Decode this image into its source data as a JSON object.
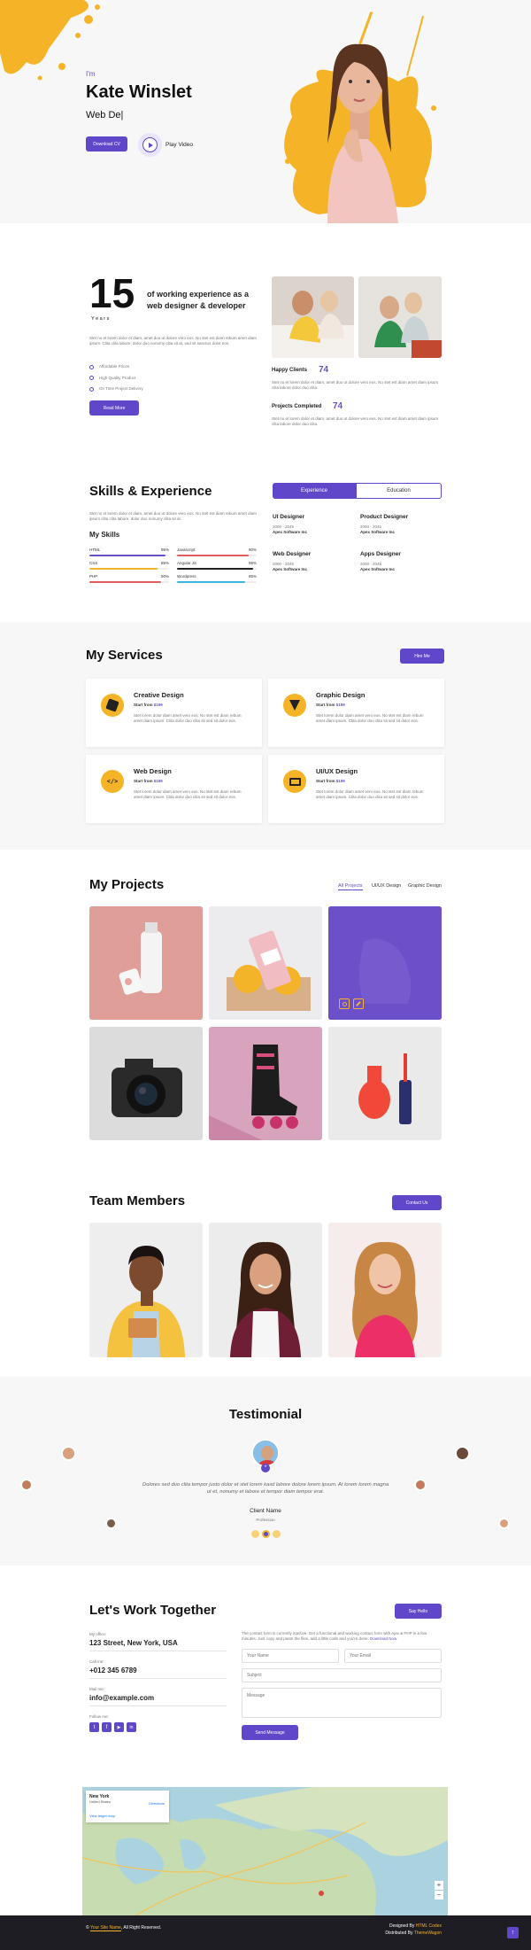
{
  "hero": {
    "im": "I'm",
    "name": "Kate Winslet",
    "role": "Web De|",
    "download_label": "Download CV",
    "play_label": "Play Video"
  },
  "about": {
    "years": "15",
    "years_label": "Y e a r s",
    "experience_text": "of working experience as a web designer & developer",
    "paragraph": "Stet no et lorem dolor et diam, amet duo ut dolore vero eos. No stet est diam rebum amet diam ipsum. Clita clita labore, dolor duo nonumy clita sit at, sed sit sanctus dolor eos.",
    "checks": [
      "Affordable Prices",
      "High Quality Product",
      "On Time Project Delivery"
    ],
    "read_more": "Read More",
    "happy_clients_label": "Happy Clients",
    "happy_clients_value": "74",
    "happy_clients_text": "Stet no et lorem dolor et diam, amet duo ut dolore vero eos. No stet est diam amet diam ipsum clita labore dolor duo clita.",
    "projects_label": "Projects Completed",
    "projects_value": "74",
    "projects_text": "Stet no et lorem dolor et diam, amet duo ut dolore vero eos. No stet est diam amet diam ipsum clita labore dolor duo clita."
  },
  "skills": {
    "title": "Skills & Experience",
    "paragraph": "Stet no et lorem dolor et diam, amet duo ut dolore vero eos. No stet est diam rebum amet diam ipsum clita clita labore, dolor duo nonumy clita sit at.",
    "my_skills": "My Skills",
    "items": [
      {
        "name": "HTML",
        "pct": "95%",
        "value": 95,
        "color": "#6a4fc7"
      },
      {
        "name": "Javascript",
        "pct": "90%",
        "value": 90,
        "color": "#e05d5d"
      },
      {
        "name": "CSS",
        "pct": "85%",
        "value": 85,
        "color": "#f0b429"
      },
      {
        "name": "Angular JS",
        "pct": "95%",
        "value": 95,
        "color": "#222222"
      },
      {
        "name": "PHP",
        "pct": "90%",
        "value": 90,
        "color": "#e05d5d"
      },
      {
        "name": "Wordpress",
        "pct": "85%",
        "value": 85,
        "color": "#3bb6e0"
      }
    ],
    "tab_experience": "Experience",
    "tab_education": "Education",
    "jobs": [
      {
        "title": "UI Designer",
        "years": "2000 - 2045",
        "company": "Apex Software Inc"
      },
      {
        "title": "Product Designer",
        "years": "2000 - 2045",
        "company": "Apex Software Inc"
      },
      {
        "title": "Web Designer",
        "years": "2000 - 2045",
        "company": "Apex Software Inc"
      },
      {
        "title": "Apps Designer",
        "years": "2000 - 2045",
        "company": "Apex Software Inc"
      }
    ]
  },
  "services": {
    "title": "My Services",
    "hire_label": "Hire Me",
    "items": [
      {
        "title": "Creative Design",
        "start": "Start from ",
        "price": "$199",
        "text": "Stet lorem dolor diam amet vero eos. No stet est diam rebum amet diam ipsum. Clita dolor duo clita sit sed sit dolor eos."
      },
      {
        "title": "Graphic Design",
        "start": "Start from ",
        "price": "$199",
        "text": "Stet lorem dolor diam amet vero eos. No stet est diam rebum amet diam ipsum. Clita dolor duo clita sit sed sit dolor eos."
      },
      {
        "title": "Web Design",
        "start": "Start from ",
        "price": "$199",
        "text": "Stet lorem dolor diam amet vero eos. No stet est diam rebum amet diam ipsum. Clita dolor duo clita sit sed sit dolor eos."
      },
      {
        "title": "UI/UX Design",
        "start": "Start from ",
        "price": "$199",
        "text": "Stet lorem dolor diam amet vero eos. No stet est diam rebum amet diam ipsum. Clita dolor duo clita sit sed sit dolor eos."
      }
    ]
  },
  "projects": {
    "title": "My Projects",
    "filters": [
      "All Projects",
      "UI/UX Design",
      "Graphic Design"
    ]
  },
  "team": {
    "title": "Team Members",
    "contact_label": "Contact Us"
  },
  "testimonial": {
    "title": "Testimonial",
    "quote": "Dolores sed duo clita tempor justo dolor et stet lorem kasd labore dolore lorem ipsum. At lorem lorem magna ut et, nonumy et labore et tempor diam tempor erat.",
    "client_name": "Client Name",
    "client_role": "Profession"
  },
  "contact": {
    "title": "Let's Work Together",
    "say_hello": "Say Hello",
    "office_label": "My office:",
    "office_value": "123 Street, New York, USA",
    "call_label": "Call me:",
    "call_value": "+012 345 6789",
    "mail_label": "Mail me:",
    "mail_value": "info@example.com",
    "follow_label": "Follow me:",
    "form_note": "The contact form is currently inactive. Get a functional and working contact form with Ajax & PHP in a few minutes. Just copy and paste the files, add a little code and you're done.",
    "download_now": "Download Now",
    "name_ph": "Your Name",
    "email_ph": "Your Email",
    "subject_ph": "Subject",
    "message_ph": "Message",
    "send_label": "Send Message"
  },
  "map": {
    "place": "New York",
    "place_sub": "United States",
    "directions": "Directions",
    "larger": "View larger map"
  },
  "footer": {
    "copy_prefix": "© ",
    "site_name": "Your Site Name",
    "copy_suffix": ", All Right Reserved.",
    "designed_prefix": "Designed By ",
    "designed_by": "HTML Codex",
    "distributed_prefix": "Distributed By ",
    "distributed_by": "ThemeWagon"
  }
}
